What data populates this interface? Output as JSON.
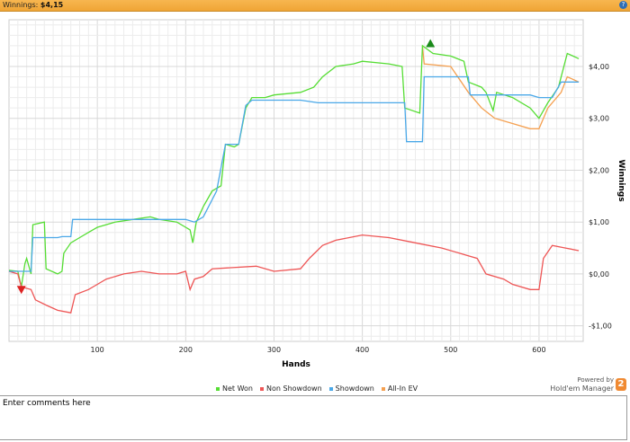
{
  "header": {
    "label": "Winnings:",
    "value": "$4,15",
    "help_icon": "?"
  },
  "comments": {
    "placeholder": "Enter comments here"
  },
  "branding": {
    "powered": "Powered by",
    "name": "Hold'em Manager",
    "logo": "2"
  },
  "chart_data": {
    "type": "line",
    "xlabel": "Hands",
    "ylabel": "Winnings",
    "xlim": [
      0,
      650
    ],
    "ylim": [
      -1.3,
      4.9
    ],
    "xticks": [
      100,
      200,
      300,
      400,
      500,
      600
    ],
    "yticks": [
      {
        "v": 4,
        "label": "$4,00"
      },
      {
        "v": 3,
        "label": "$3,00"
      },
      {
        "v": 2,
        "label": "$2,00"
      },
      {
        "v": 1,
        "label": "$1,00"
      },
      {
        "v": 0,
        "label": "$0,00"
      },
      {
        "v": -1,
        "label": "-$1,00"
      }
    ],
    "grid": true,
    "legend_position": "bottom",
    "series": [
      {
        "name": "Net Won",
        "color": "#55dd33",
        "points": [
          [
            0,
            0.07
          ],
          [
            10,
            0.05
          ],
          [
            14,
            -0.25
          ],
          [
            18,
            0.2
          ],
          [
            20,
            0.3
          ],
          [
            25,
            0.0
          ],
          [
            27,
            0.95
          ],
          [
            40,
            1.0
          ],
          [
            42,
            0.1
          ],
          [
            55,
            0.0
          ],
          [
            60,
            0.05
          ],
          [
            62,
            0.4
          ],
          [
            70,
            0.6
          ],
          [
            80,
            0.7
          ],
          [
            90,
            0.8
          ],
          [
            100,
            0.9
          ],
          [
            120,
            1.0
          ],
          [
            140,
            1.05
          ],
          [
            160,
            1.1
          ],
          [
            170,
            1.05
          ],
          [
            190,
            1.0
          ],
          [
            200,
            0.9
          ],
          [
            205,
            0.85
          ],
          [
            208,
            0.6
          ],
          [
            212,
            1.0
          ],
          [
            220,
            1.3
          ],
          [
            230,
            1.6
          ],
          [
            240,
            1.7
          ],
          [
            245,
            2.5
          ],
          [
            255,
            2.45
          ],
          [
            260,
            2.5
          ],
          [
            268,
            3.2
          ],
          [
            275,
            3.4
          ],
          [
            290,
            3.4
          ],
          [
            300,
            3.45
          ],
          [
            330,
            3.5
          ],
          [
            345,
            3.6
          ],
          [
            355,
            3.8
          ],
          [
            370,
            4.0
          ],
          [
            390,
            4.05
          ],
          [
            400,
            4.1
          ],
          [
            430,
            4.05
          ],
          [
            445,
            4.0
          ],
          [
            448,
            3.2
          ],
          [
            465,
            3.1
          ],
          [
            468,
            4.4
          ],
          [
            480,
            4.25
          ],
          [
            500,
            4.2
          ],
          [
            515,
            4.1
          ],
          [
            520,
            3.7
          ],
          [
            535,
            3.6
          ],
          [
            540,
            3.5
          ],
          [
            548,
            3.15
          ],
          [
            552,
            3.5
          ],
          [
            570,
            3.4
          ],
          [
            590,
            3.2
          ],
          [
            600,
            3.0
          ],
          [
            610,
            3.3
          ],
          [
            622,
            3.6
          ],
          [
            632,
            4.25
          ],
          [
            645,
            4.15
          ]
        ]
      },
      {
        "name": "Non Showdown",
        "color": "#ee5555",
        "points": [
          [
            0,
            0.05
          ],
          [
            10,
            0.0
          ],
          [
            14,
            -0.25
          ],
          [
            25,
            -0.3
          ],
          [
            30,
            -0.5
          ],
          [
            42,
            -0.6
          ],
          [
            55,
            -0.7
          ],
          [
            70,
            -0.75
          ],
          [
            75,
            -0.4
          ],
          [
            90,
            -0.3
          ],
          [
            100,
            -0.2
          ],
          [
            110,
            -0.1
          ],
          [
            130,
            0.0
          ],
          [
            150,
            0.05
          ],
          [
            170,
            0.0
          ],
          [
            190,
            0.0
          ],
          [
            200,
            0.05
          ],
          [
            205,
            -0.3
          ],
          [
            210,
            -0.1
          ],
          [
            220,
            -0.05
          ],
          [
            230,
            0.1
          ],
          [
            280,
            0.15
          ],
          [
            300,
            0.05
          ],
          [
            330,
            0.1
          ],
          [
            340,
            0.3
          ],
          [
            355,
            0.55
          ],
          [
            370,
            0.65
          ],
          [
            400,
            0.75
          ],
          [
            430,
            0.7
          ],
          [
            460,
            0.6
          ],
          [
            490,
            0.5
          ],
          [
            520,
            0.35
          ],
          [
            530,
            0.3
          ],
          [
            540,
            0.0
          ],
          [
            560,
            -0.1
          ],
          [
            570,
            -0.2
          ],
          [
            590,
            -0.3
          ],
          [
            600,
            -0.3
          ],
          [
            605,
            0.3
          ],
          [
            615,
            0.55
          ],
          [
            630,
            0.5
          ],
          [
            645,
            0.45
          ]
        ]
      },
      {
        "name": "Showdown",
        "color": "#4aa8e8",
        "points": [
          [
            0,
            0.05
          ],
          [
            25,
            0.05
          ],
          [
            27,
            0.7
          ],
          [
            55,
            0.7
          ],
          [
            60,
            0.72
          ],
          [
            70,
            0.72
          ],
          [
            72,
            1.05
          ],
          [
            200,
            1.05
          ],
          [
            210,
            1.0
          ],
          [
            220,
            1.1
          ],
          [
            235,
            1.6
          ],
          [
            245,
            2.5
          ],
          [
            260,
            2.5
          ],
          [
            268,
            3.25
          ],
          [
            275,
            3.35
          ],
          [
            330,
            3.35
          ],
          [
            350,
            3.3
          ],
          [
            448,
            3.3
          ],
          [
            450,
            2.55
          ],
          [
            468,
            2.55
          ],
          [
            470,
            3.8
          ],
          [
            520,
            3.8
          ],
          [
            522,
            3.45
          ],
          [
            590,
            3.45
          ],
          [
            600,
            3.4
          ],
          [
            615,
            3.4
          ],
          [
            625,
            3.7
          ],
          [
            645,
            3.7
          ]
        ]
      },
      {
        "name": "All-In EV",
        "color": "#f5a050",
        "points": [
          [
            468,
            4.4
          ],
          [
            470,
            4.05
          ],
          [
            500,
            4.0
          ],
          [
            520,
            3.5
          ],
          [
            535,
            3.2
          ],
          [
            550,
            3.0
          ],
          [
            570,
            2.9
          ],
          [
            590,
            2.8
          ],
          [
            600,
            2.8
          ],
          [
            610,
            3.2
          ],
          [
            625,
            3.5
          ],
          [
            632,
            3.8
          ],
          [
            645,
            3.7
          ]
        ]
      }
    ],
    "markers": [
      {
        "type": "max",
        "x": 477,
        "y": 4.44,
        "color": "#1a8a1a"
      },
      {
        "type": "min",
        "x": 14,
        "y": -0.3,
        "color": "#dd2222"
      }
    ]
  }
}
